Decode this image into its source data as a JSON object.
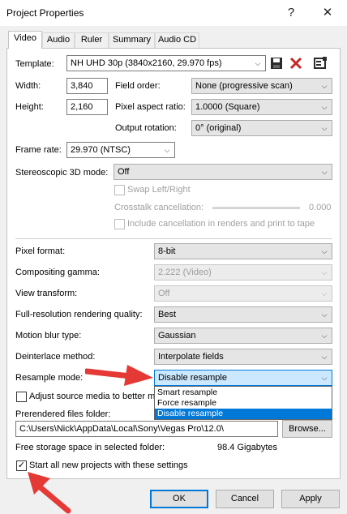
{
  "window": {
    "title": "Project Properties",
    "help_label": "?",
    "close_label": "✕"
  },
  "tabs": [
    {
      "label": "Video"
    },
    {
      "label": "Audio"
    },
    {
      "label": "Ruler"
    },
    {
      "label": "Summary"
    },
    {
      "label": "Audio CD"
    }
  ],
  "template": {
    "label": "Template:",
    "value": "NH UHD 30p (3840x2160, 29.970 fps)"
  },
  "width": {
    "label": "Width:",
    "value": "3,840"
  },
  "height": {
    "label": "Height:",
    "value": "2,160"
  },
  "field_order": {
    "label": "Field order:",
    "value": "None (progressive scan)"
  },
  "pixel_aspect": {
    "label": "Pixel aspect ratio:",
    "value": "1.0000 (Square)"
  },
  "output_rotation": {
    "label": "Output rotation:",
    "value": "0° (original)"
  },
  "frame_rate": {
    "label": "Frame rate:",
    "value": "29.970 (NTSC)"
  },
  "stereo": {
    "label": "Stereoscopic 3D mode:",
    "value": "Off"
  },
  "swap": {
    "label": "Swap Left/Right"
  },
  "crosstalk": {
    "label": "Crosstalk cancellation:",
    "value": "0.000"
  },
  "include_cancel": {
    "label": "Include cancellation in renders and print to tape"
  },
  "pixel_format": {
    "label": "Pixel format:",
    "value": "8-bit"
  },
  "compositing_gamma": {
    "label": "Compositing gamma:",
    "value": "2.222 (Video)"
  },
  "view_transform": {
    "label": "View transform:",
    "value": "Off"
  },
  "render_quality": {
    "label": "Full-resolution rendering quality:",
    "value": "Best"
  },
  "motion_blur": {
    "label": "Motion blur type:",
    "value": "Gaussian"
  },
  "deinterlace": {
    "label": "Deinterlace method:",
    "value": "Interpolate fields"
  },
  "resample": {
    "label": "Resample mode:",
    "value": "Disable resample",
    "options": [
      "Smart resample",
      "Force resample",
      "Disable resample"
    ]
  },
  "adjust_media": {
    "label": "Adjust source media to better ma"
  },
  "prerendered": {
    "label": "Prerendered files folder:",
    "value": "C:\\Users\\Nick\\AppData\\Local\\Sony\\Vegas Pro\\12.0\\",
    "browse_label": "Browse..."
  },
  "storage": {
    "label": "Free storage space in selected folder:",
    "value": "98.4 Gigabytes"
  },
  "start_new": {
    "label": "Start all new projects with these settings",
    "checked_glyph": "✓"
  },
  "buttons": {
    "ok": "OK",
    "cancel": "Cancel",
    "apply": "Apply"
  },
  "annotation_color": "#e53935",
  "accent_color": "#0078d7",
  "icons": [
    "save-icon",
    "delete-icon",
    "template-settings-icon",
    "dropdown-arrow-icon",
    "checkmark-icon",
    "red-arrow-annotation"
  ]
}
